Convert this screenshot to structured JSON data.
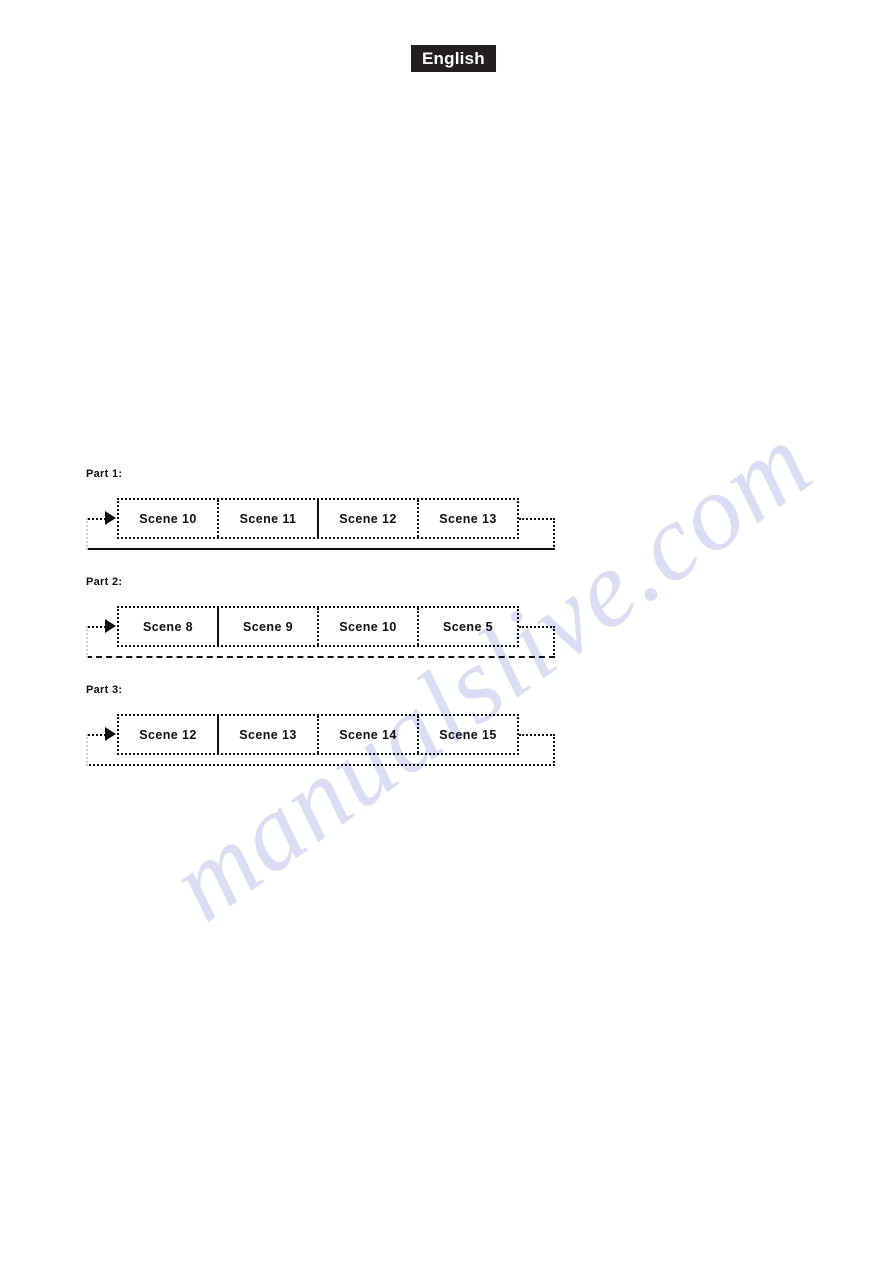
{
  "page": {
    "language_badge": "English",
    "watermark": "manualslive.com"
  },
  "diagrams": [
    {
      "id": "part-1",
      "label": "Part 1:",
      "scenes": [
        "Scene 10",
        "Scene 11",
        "Scene 12",
        "Scene 13"
      ],
      "divider_after_index": 1,
      "return_line_style": "solid"
    },
    {
      "id": "part-2",
      "label": "Part 2:",
      "scenes": [
        "Scene 8",
        "Scene 9",
        "Scene 10",
        "Scene 5"
      ],
      "divider_after_index": 0,
      "return_line_style": "dashed"
    },
    {
      "id": "part-3",
      "label": "Part 3:",
      "scenes": [
        "Scene 12",
        "Scene 13",
        "Scene 14",
        "Scene 15"
      ],
      "divider_after_index": 0,
      "return_line_style": "dotted"
    }
  ]
}
